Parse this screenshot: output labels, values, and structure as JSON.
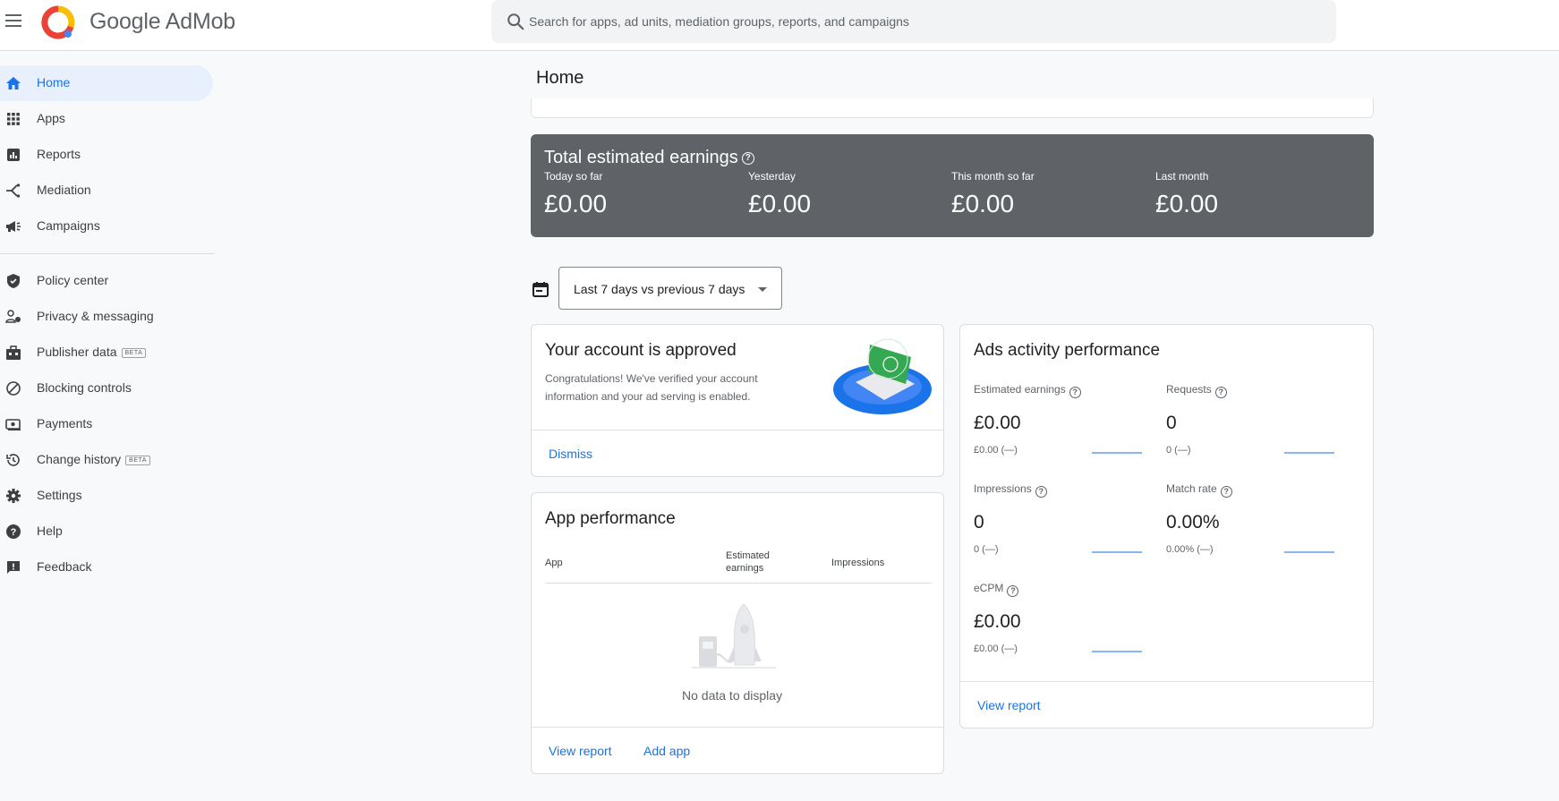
{
  "header": {
    "brand": "Google AdMob",
    "search_placeholder": "Search for apps, ad units, mediation groups, reports, and campaigns"
  },
  "sidebar": {
    "items": [
      {
        "label": "Home",
        "icon": "home-icon",
        "active": true
      },
      {
        "label": "Apps",
        "icon": "apps-grid-icon"
      },
      {
        "label": "Reports",
        "icon": "reports-icon"
      },
      {
        "label": "Mediation",
        "icon": "mediation-icon"
      },
      {
        "label": "Campaigns",
        "icon": "megaphone-icon"
      },
      {
        "label": "Policy center",
        "icon": "shield-icon"
      },
      {
        "label": "Privacy & messaging",
        "icon": "privacy-icon"
      },
      {
        "label": "Publisher data",
        "icon": "publisher-data-icon",
        "badge": "BETA"
      },
      {
        "label": "Blocking controls",
        "icon": "block-icon"
      },
      {
        "label": "Payments",
        "icon": "payments-icon"
      },
      {
        "label": "Change history",
        "icon": "history-icon",
        "badge": "BETA"
      },
      {
        "label": "Settings",
        "icon": "gear-icon"
      },
      {
        "label": "Help",
        "icon": "help-icon"
      },
      {
        "label": "Feedback",
        "icon": "feedback-icon"
      }
    ]
  },
  "main": {
    "title": "Home",
    "earnings": {
      "title": "Total estimated earnings",
      "columns": [
        {
          "label": "Today so far",
          "value": "£0.00"
        },
        {
          "label": "Yesterday",
          "value": "£0.00"
        },
        {
          "label": "This month so far",
          "value": "£0.00"
        },
        {
          "label": "Last month",
          "value": "£0.00"
        }
      ]
    },
    "date_range": "Last 7 days vs previous 7 days",
    "approved": {
      "title": "Your account is approved",
      "description": "Congratulations! We've verified your account information and your ad serving is enabled.",
      "dismiss": "Dismiss"
    },
    "app_performance": {
      "title": "App performance",
      "columns": [
        "App",
        "Estimated earnings",
        "Impressions"
      ],
      "empty": "No data to display",
      "view_report": "View report",
      "add_app": "Add app"
    },
    "ads_activity": {
      "title": "Ads activity performance",
      "metrics": [
        {
          "label": "Estimated earnings",
          "value": "£0.00",
          "sub": "£0.00 (—)"
        },
        {
          "label": "Requests",
          "value": "0",
          "sub": "0 (—)"
        },
        {
          "label": "Impressions",
          "value": "0",
          "sub": "0 (—)"
        },
        {
          "label": "Match rate",
          "value": "0.00%",
          "sub": "0.00% (—)"
        },
        {
          "label": "eCPM",
          "value": "£0.00",
          "sub": "£0.00 (—)"
        }
      ],
      "view_report": "View report"
    }
  },
  "colors": {
    "accent": "#1a73e8",
    "earnings_bg": "#5f6368",
    "active_nav_bg": "#e8f0fe"
  }
}
